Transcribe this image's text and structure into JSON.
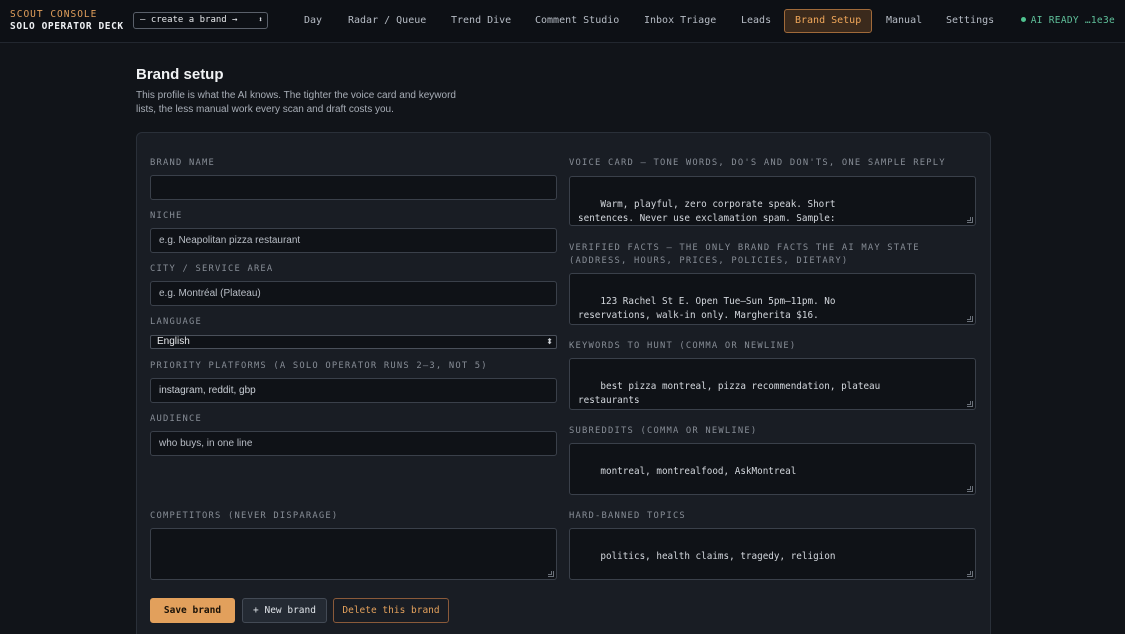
{
  "app": {
    "title_top": "SCOUT CONSOLE",
    "title_bottom": "SOLO OPERATOR DECK",
    "brand_select_value": "— create a brand →",
    "ai_status": "AI READY …1e3e"
  },
  "nav": [
    {
      "label": "Day"
    },
    {
      "label": "Radar / Queue"
    },
    {
      "label": "Trend Dive"
    },
    {
      "label": "Comment Studio"
    },
    {
      "label": "Inbox Triage"
    },
    {
      "label": "Leads"
    },
    {
      "label": "Brand Setup",
      "active": true
    },
    {
      "label": "Manual"
    },
    {
      "label": "Settings"
    }
  ],
  "page": {
    "title": "Brand setup",
    "description": "This profile is what the AI knows. The tighter the voice card and keyword lists, the less manual work every scan and draft costs you."
  },
  "form": {
    "brand_name": {
      "label": "BRAND NAME",
      "value": ""
    },
    "niche": {
      "label": "NICHE",
      "placeholder": "e.g. Neapolitan pizza restaurant"
    },
    "city": {
      "label": "CITY / SERVICE AREA",
      "placeholder": "e.g. Montréal (Plateau)"
    },
    "language": {
      "label": "LANGUAGE",
      "value": "English"
    },
    "platforms": {
      "label": "PRIORITY PLATFORMS (A SOLO OPERATOR RUNS 2–3, NOT 5)",
      "value": "instagram, reddit, gbp"
    },
    "audience": {
      "label": "AUDIENCE",
      "placeholder": "who buys, in one line"
    },
    "competitors": {
      "label": "COMPETITORS (NEVER DISPARAGE)",
      "value": ""
    },
    "voice_card": {
      "label": "VOICE CARD — TONE WORDS, DO'S AND DON'TS, ONE SAMPLE REPLY",
      "value": "Warm, playful, zero corporate speak. Short\nsentences. Never use exclamation spam. Sample:\n'okay the crust technique here is actually solid —"
    },
    "verified_facts": {
      "label_line1": "VERIFIED FACTS — THE ONLY BRAND FACTS THE AI MAY STATE",
      "label_line2": "(ADDRESS, HOURS, PRICES, POLICIES, DIETARY)",
      "value": "123 Rachel St E. Open Tue–Sun 5pm–11pm. No\nreservations, walk-in only. Margherita $16.\nGluten-free crust available (shared oven — not"
    },
    "keywords": {
      "label": "KEYWORDS TO HUNT (COMMA OR NEWLINE)",
      "value": "best pizza montreal, pizza recommendation, plateau\nrestaurants"
    },
    "subreddits": {
      "label": "SUBREDDITS (COMMA OR NEWLINE)",
      "value": "montreal, montrealfood, AskMontreal"
    },
    "banned_topics": {
      "label": "HARD-BANNED TOPICS",
      "value": "politics, health claims, tragedy, religion"
    }
  },
  "actions": {
    "save": "Save brand",
    "new": "+ New brand",
    "delete": "Delete this brand"
  }
}
